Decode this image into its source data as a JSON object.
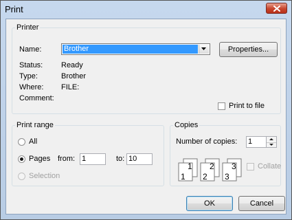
{
  "window": {
    "title": "Print",
    "close_icon": "close-icon"
  },
  "printer": {
    "legend": "Printer",
    "name_label": "Name:",
    "name_value": "Brother",
    "properties_label": "Properties...",
    "status_label": "Status:",
    "status_value": "Ready",
    "type_label": "Type:",
    "type_value": "Brother",
    "where_label": "Where:",
    "where_value": "FILE:",
    "comment_label": "Comment:",
    "comment_value": "",
    "print_to_file_label": "Print to file",
    "print_to_file_checked": false
  },
  "print_range": {
    "legend": "Print range",
    "all_label": "All",
    "pages_label": "Pages",
    "from_label": "from:",
    "from_value": "1",
    "to_label": "to:",
    "to_value": "10",
    "selection_label": "Selection",
    "selected": "Pages"
  },
  "copies": {
    "legend": "Copies",
    "number_label": "Number of copies:",
    "number_value": "1",
    "collate_label": "Collate",
    "collate_checked": false,
    "collate_icon": "collate-pages-icon"
  },
  "buttons": {
    "ok_label": "OK",
    "cancel_label": "Cancel"
  },
  "colors": {
    "selection": "#3399ff",
    "title_bar": "#b9cde4",
    "close_button": "#c7442c",
    "dialog_face": "#f0f0f0"
  }
}
